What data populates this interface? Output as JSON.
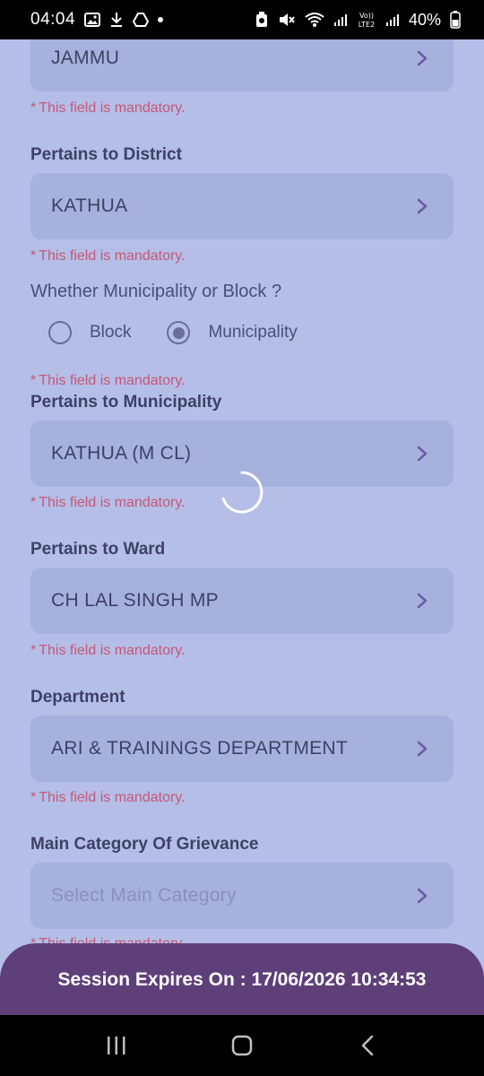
{
  "status_bar": {
    "time": "04:04",
    "battery": "40%"
  },
  "form": {
    "division_value": "JAMMU",
    "mandatory_text": "This field is mandatory.",
    "mandatory_star": "*",
    "district_label": "Pertains to District",
    "district_value": "KATHUA",
    "muni_or_block_question": "Whether Municipality or Block ?",
    "radio_block": "Block",
    "radio_municipality": "Municipality",
    "selected_option": "Municipality",
    "municipality_label": "Pertains to Municipality",
    "municipality_value": "KATHUA (M CL)",
    "ward_label": "Pertains to Ward",
    "ward_value": "CH LAL SINGH MP",
    "department_label": "Department",
    "department_value": "ARI & TRAININGS DEPARTMENT",
    "main_category_label": "Main Category Of Grievance",
    "main_category_placeholder": "Select Main Category"
  },
  "session": {
    "text": "Session Expires On : 17/06/2026 10:34:53"
  },
  "colors": {
    "background": "#b4bee6",
    "field": "#a6b1dc",
    "accent": "#5e3f7a",
    "error": "#c8587a",
    "chevron": "#6b5ba8"
  },
  "icons": [
    "image-icon",
    "download-icon",
    "drive-icon",
    "recycle-icon",
    "mute-icon",
    "wifi-icon",
    "signal-icon",
    "volte-icon",
    "battery-icon",
    "chevron-right-icon",
    "recents-icon",
    "home-icon",
    "back-icon"
  ]
}
